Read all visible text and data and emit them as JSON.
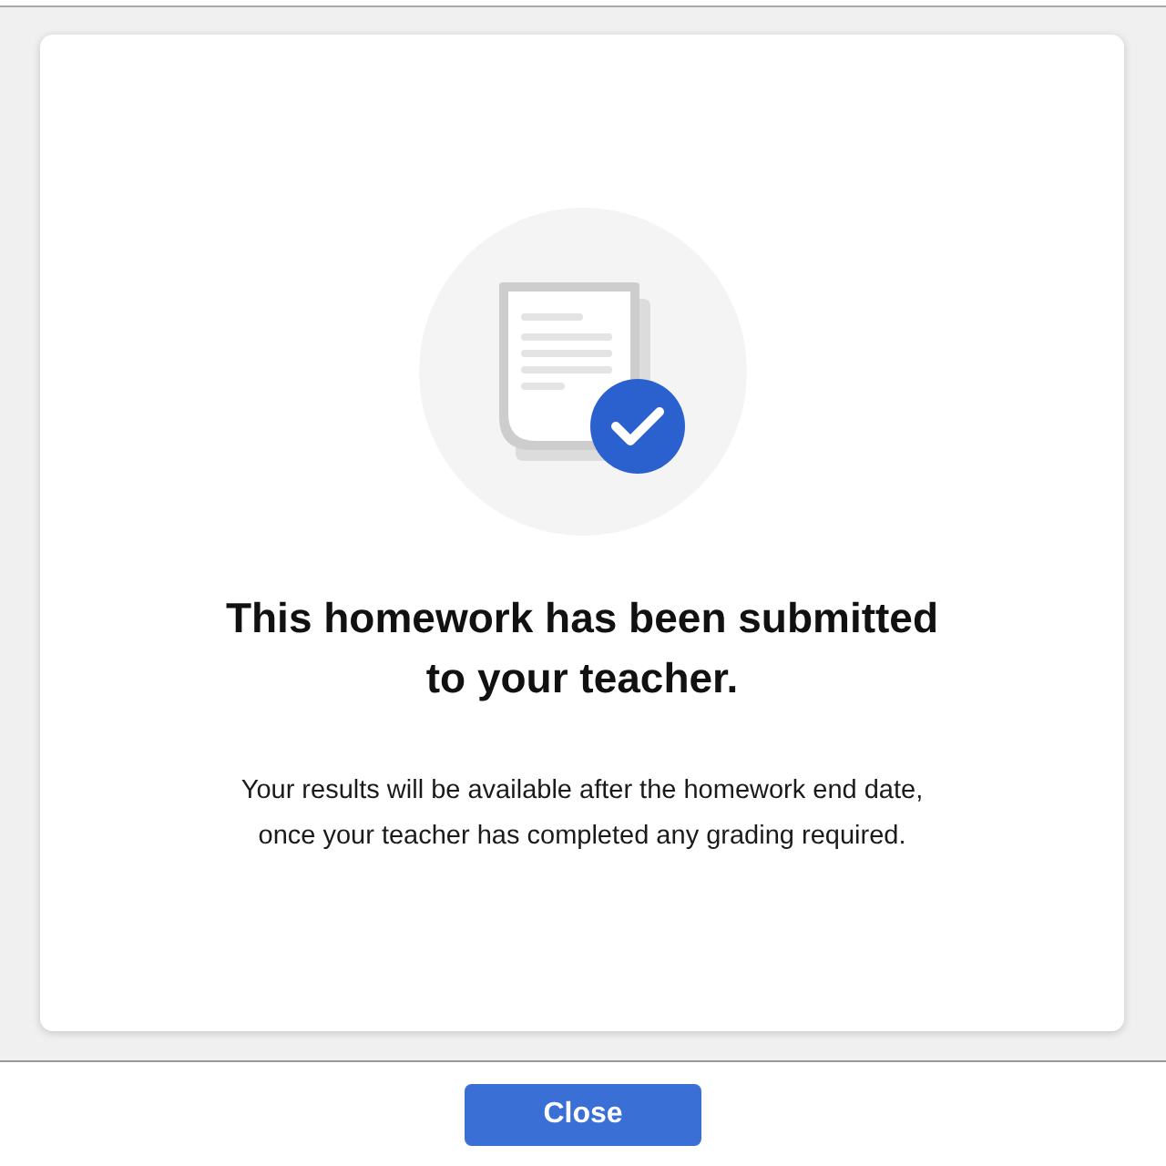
{
  "dialog": {
    "title": "This homework has been submitted\nto your teacher.",
    "message": "Your results will be available after the homework end date,\nonce your teacher has completed any grading required.",
    "buttons": [
      {
        "label": "Close",
        "kind": "primary"
      }
    ]
  }
}
